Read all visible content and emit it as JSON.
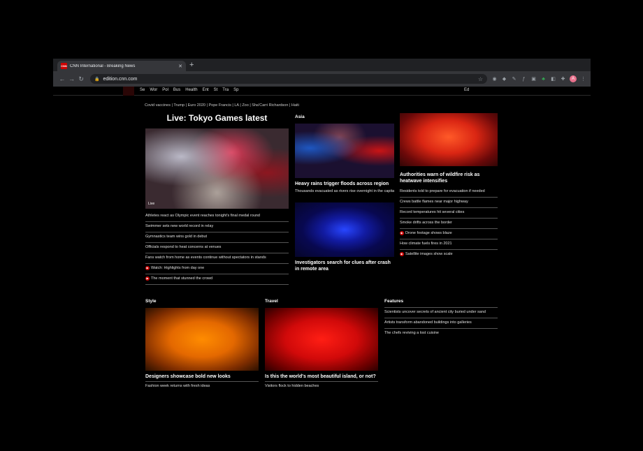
{
  "browser": {
    "tab_title": "CNN International - Breaking News",
    "favicon_text": "CNN",
    "url": "edition.cnn.com",
    "profile_initial": "A"
  },
  "icons": {
    "back": "←",
    "forward": "→",
    "reload": "↻",
    "lock": "🔒",
    "star": "☆",
    "close": "✕",
    "new_tab": "+",
    "menu": "⋮",
    "extensions": "✚"
  },
  "site_nav": {
    "items": [
      "Se",
      "Wor",
      "Pol",
      "Bus",
      "Health",
      "Ent",
      "St",
      "Tra",
      "Sp"
    ],
    "right": "Ed"
  },
  "ticker": {
    "items": [
      "Covid vaccines",
      "Trump",
      "Euro 2020",
      "Pope Francis",
      "LA",
      "Zoo",
      "Sha'Carri Richardson",
      "Haiti"
    ]
  },
  "col1": {
    "main_headline": "Live: Tokyo Games latest",
    "image_caption": "Live",
    "rows": [
      {
        "text": "Athletes react as Olympic event reaches tonight's final medal round",
        "video": false
      },
      {
        "text": "Swimmer sets new world record in relay",
        "video": false
      },
      {
        "text": "Gymnastics team wins gold in debut",
        "video": false
      },
      {
        "text": "Officials respond to heat concerns at venues",
        "video": false
      },
      {
        "text": "Fans watch from home as events continue without spectators in stands",
        "video": false
      },
      {
        "text": "Watch: Highlights from day one",
        "video": true
      },
      {
        "text": "The moment that stunned the crowd",
        "video": true
      }
    ]
  },
  "col2": {
    "section": "Asia",
    "story1_title": "Heavy rains trigger floods across region",
    "story1_summary": "Thousands evacuated as rivers rise overnight in the capital",
    "story2_title": "Investigators search for clues after crash in remote area"
  },
  "col3": {
    "story_title": "Authorities warn of wildfire risk as heatwave intensifies",
    "rows": [
      {
        "text": "Residents told to prepare for evacuation if needed",
        "video": false
      },
      {
        "text": "Crews battle flames near major highway",
        "video": false
      },
      {
        "text": "Record temperatures hit several cities",
        "video": false
      },
      {
        "text": "Smoke drifts across the border",
        "video": false
      },
      {
        "text": "Drone footage shows blaze",
        "video": true
      },
      {
        "text": "How climate fuels fires in 2021",
        "video": false
      },
      {
        "text": "Satellite images show scale",
        "video": true
      }
    ]
  },
  "bottom1": {
    "section": "Style",
    "title": "Designers showcase bold new looks",
    "summary": "Fashion week returns with fresh ideas"
  },
  "bottom2": {
    "section": "Travel",
    "title": "Is this the world's most beautiful island, or not?",
    "summary": "Visitors flock to hidden beaches"
  },
  "bottom3": {
    "section": "Features",
    "rows": [
      "Scientists uncover secrets of ancient city buried under sand",
      "Artists transform abandoned buildings into galleries",
      "The chefs reviving a lost cuisine"
    ]
  }
}
